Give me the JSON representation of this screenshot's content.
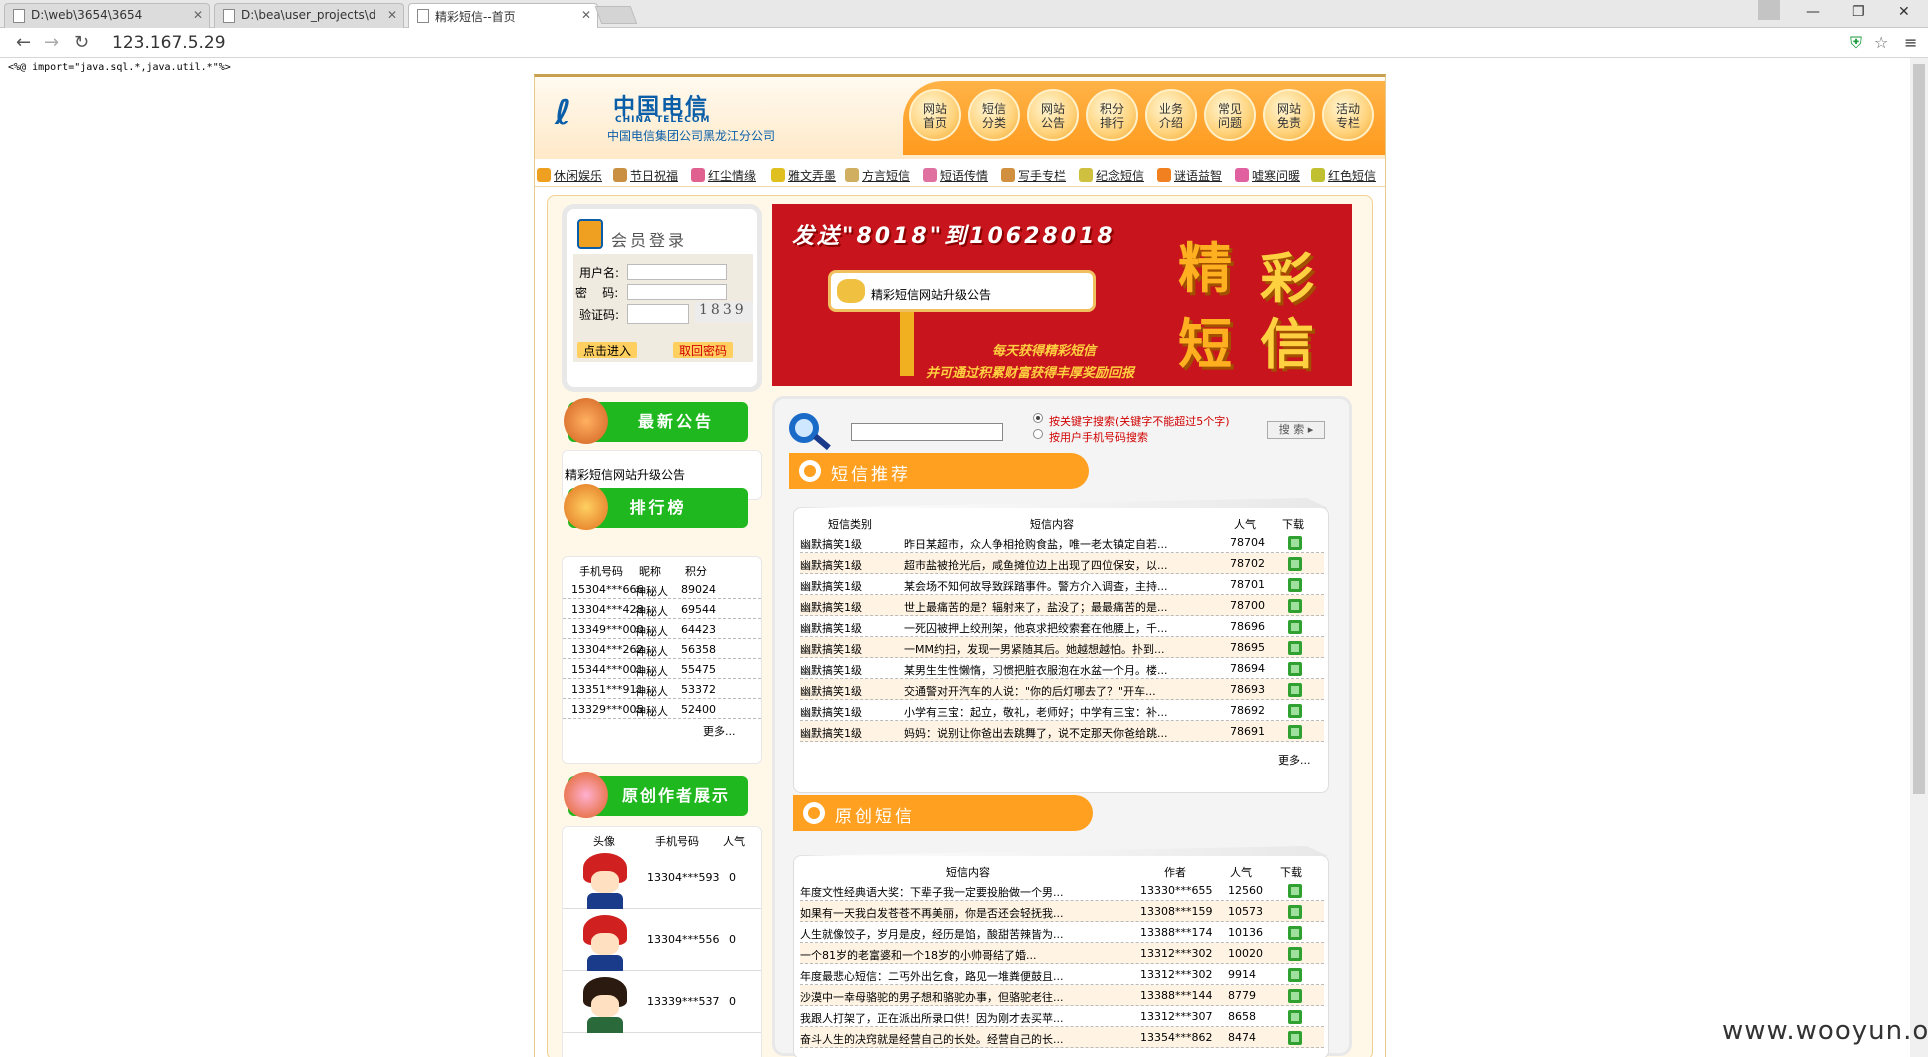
{
  "browser": {
    "tabs": [
      {
        "label": "D:\\web\\3654\\3654"
      },
      {
        "label": "D:\\bea\\user_projects\\dc"
      },
      {
        "label": "精彩短信--首页"
      }
    ],
    "url": "123.167.5.29"
  },
  "jsp_directive": "<%@ import=\"java.sql.*,java.util.*\"%>",
  "header": {
    "logo_cn": "中国电信",
    "logo_en": "CHINA TELECOM",
    "logo_sub": "中国电信集团公司黑龙江分公司",
    "nav": [
      {
        "line1": "网站",
        "line2": "首页"
      },
      {
        "line1": "短信",
        "line2": "分类"
      },
      {
        "line1": "网站",
        "line2": "公告"
      },
      {
        "line1": "积分",
        "line2": "排行"
      },
      {
        "line1": "业务",
        "line2": "介绍"
      },
      {
        "line1": "常见",
        "line2": "问题"
      },
      {
        "line1": "网站",
        "line2": "免责"
      },
      {
        "line1": "活动",
        "line2": "专栏"
      }
    ]
  },
  "subnav": [
    "休闲娱乐",
    "节日祝福",
    "红尘情缘",
    "雅文弄墨",
    "方言短信",
    "短语传情",
    "写手专栏",
    "纪念短信",
    "谜语益智",
    "嘘寒问暖",
    "红色短信"
  ],
  "login": {
    "title": "会员登录",
    "username_label": "用户名:",
    "password_label": "密    码:",
    "captcha_label": "验证码:",
    "captcha_value": "1839",
    "submit_label": "点击进入",
    "recover_label": "取回密码"
  },
  "left": {
    "notice_title": "最新公告",
    "notice_text": "精彩短信网站升级公告",
    "ranking_title": "排行榜",
    "ranking_headers": [
      "手机号码",
      "昵称",
      "积分"
    ],
    "ranking_rows": [
      [
        "15304***666",
        "神秘人",
        "89024"
      ],
      [
        "13304***428",
        "神秘人",
        "69544"
      ],
      [
        "13349***000",
        "神秘人",
        "64423"
      ],
      [
        "13304***262",
        "神秘人",
        "56358"
      ],
      [
        "15344***001",
        "神秘人",
        "55475"
      ],
      [
        "13351***911",
        "神秘人",
        "53372"
      ],
      [
        "13329***005",
        "神秘人",
        "52400"
      ]
    ],
    "ranking_more": "更多...",
    "author_title": "原创作者展示",
    "author_headers": [
      "头像",
      "手机号码",
      "人气"
    ],
    "author_rows": [
      [
        "13304***593",
        "0"
      ],
      [
        "13304***556",
        "0"
      ],
      [
        "13339***537",
        "0"
      ]
    ]
  },
  "banner": {
    "headline": "发送\"8018\"到10628018",
    "notice": "精彩短信网站升级公告",
    "slogan1": "每天获得精彩短信",
    "slogan2": "并可通过积累财富获得丰厚奖励回报",
    "big_chars": [
      "精",
      "彩",
      "短",
      "信"
    ]
  },
  "search": {
    "option1": "按关键字搜索(关键字不能超过5个字)",
    "option2": "按用户手机号码搜索",
    "button": "搜 索"
  },
  "recommend": {
    "title": "短信推荐",
    "headers": [
      "短信类别",
      "短信内容",
      "人气",
      "下载"
    ],
    "rows": [
      [
        "幽默搞笑1级",
        "昨日某超市，众人争相抢购食盐，唯一老太镇定自若...",
        "78704"
      ],
      [
        "幽默搞笑1级",
        "超市盐被抢光后，咸鱼摊位边上出现了四位保安，以...",
        "78702"
      ],
      [
        "幽默搞笑1级",
        "某会场不知何故导致踩踏事件。警方介入调查，主持...",
        "78701"
      ],
      [
        "幽默搞笑1级",
        "世上最痛苦的是？辐射来了，盐没了；最最痛苦的是...",
        "78700"
      ],
      [
        "幽默搞笑1级",
        "一死囚被押上绞刑架，他哀求把绞索套在他腰上，千...",
        "78696"
      ],
      [
        "幽默搞笑1级",
        "一MM约扫，发现一男紧随其后。她越想越怕。扑到...",
        "78695"
      ],
      [
        "幽默搞笑1级",
        "某男生生性懒惰，习惯把脏衣服泡在水盆一个月。楼...",
        "78694"
      ],
      [
        "幽默搞笑1级",
        "交通警对开汽车的人说：\"你的后灯哪去了？\"开车...",
        "78693"
      ],
      [
        "幽默搞笑1级",
        "小学有三宝：起立，敬礼，老师好；中学有三宝：补...",
        "78692"
      ],
      [
        "幽默搞笑1级",
        "妈妈：说别让你爸出去跳舞了，说不定那天你爸给跳...",
        "78691"
      ]
    ],
    "more": "更多..."
  },
  "original": {
    "title": "原创短信",
    "headers": [
      "短信内容",
      "作者",
      "人气",
      "下载"
    ],
    "rows": [
      [
        "年度文性经典语大奖：下辈子我一定要投胎做一个男...",
        "13330***655",
        "12560"
      ],
      [
        "如果有一天我白发苍苍不再美丽，你是否还会轻抚我...",
        "13308***159",
        "10573"
      ],
      [
        "人生就像饺子，岁月是皮，经历是馅，酸甜苦辣皆为...",
        "13388***174",
        "10136"
      ],
      [
        "一个81岁的老富婆和一个18岁的小帅哥结了婚...",
        "13312***302",
        "10020"
      ],
      [
        "年度最悲心短信：二丐外出乞食，路见一堆粪便鼓且...",
        "13312***302",
        "9914"
      ],
      [
        "沙漠中一幸母骆驼的男子想和骆驼办事，但骆驼老往...",
        "13388***144",
        "8779"
      ],
      [
        "我跟人打架了，正在派出所录口供！因为刚才去买苹...",
        "13312***307",
        "8658"
      ],
      [
        "奋斗人生的决窍就是经营自己的长处。经营自己的长...",
        "13354***862",
        "8474"
      ]
    ]
  },
  "watermark": "www.wooyun.org"
}
